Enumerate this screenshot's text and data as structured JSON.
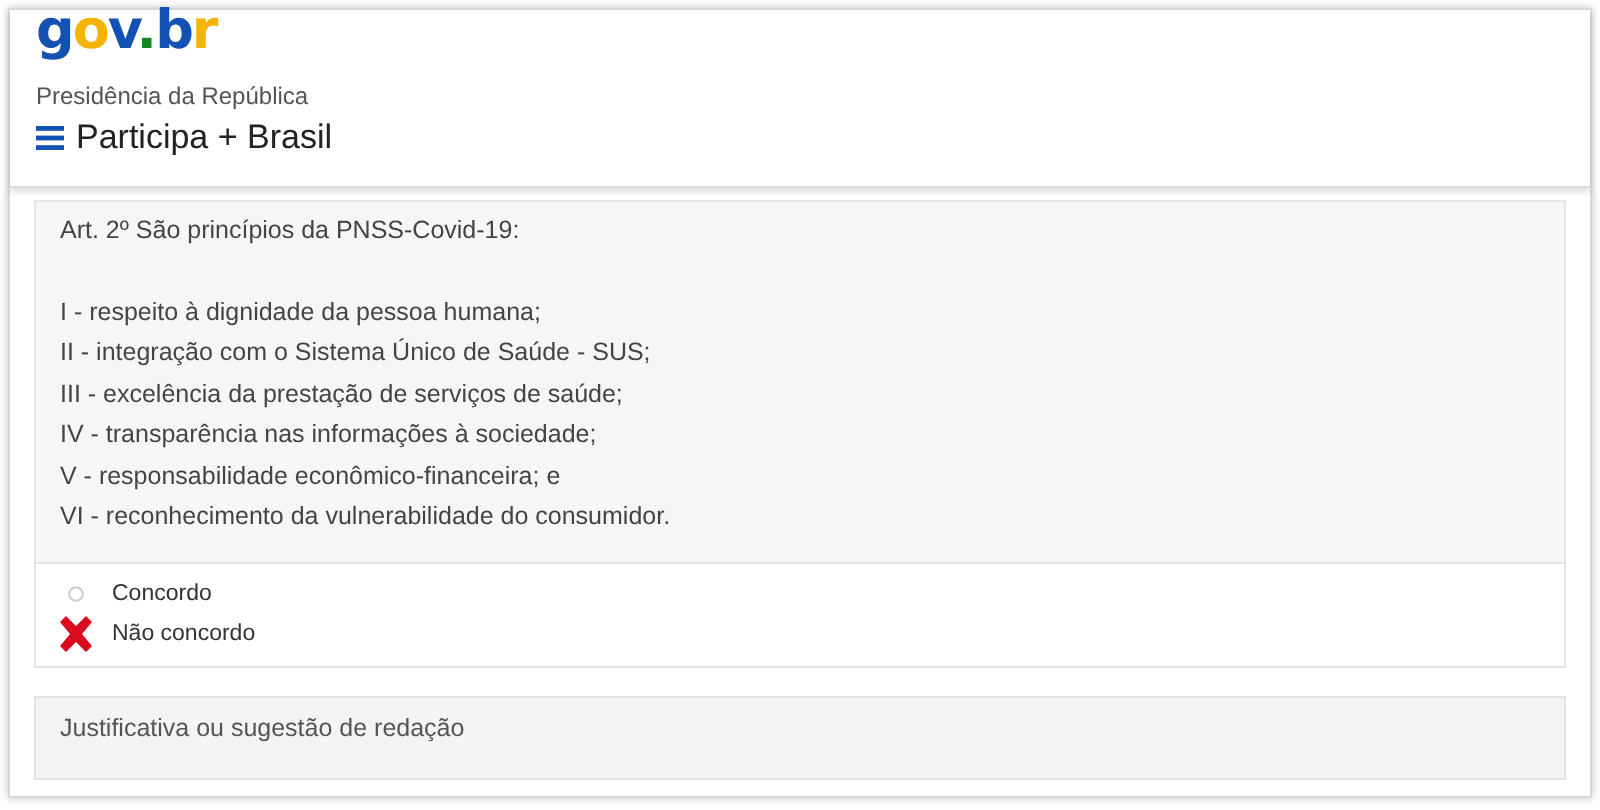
{
  "header": {
    "logo": "gov.br",
    "org": "Presidência da República",
    "site_title": "Participa + Brasil"
  },
  "article": {
    "heading": "Art. 2º São princípios da PNSS-Covid-19:",
    "items": [
      "I - respeito à dignidade da pessoa humana;",
      "II - integração com o Sistema Único de Saúde - SUS;",
      "III - excelência da prestação de serviços de saúde;",
      "IV - transparência nas informações à sociedade;",
      "V - responsabilidade econômico-financeira; e",
      "VI - reconhecimento da vulnerabilidade do consumidor."
    ]
  },
  "options": [
    {
      "label": "Concordo",
      "selected": false
    },
    {
      "label": "Não concordo",
      "selected": true
    }
  ],
  "justification": {
    "label": "Justificativa ou sugestão de redação"
  }
}
